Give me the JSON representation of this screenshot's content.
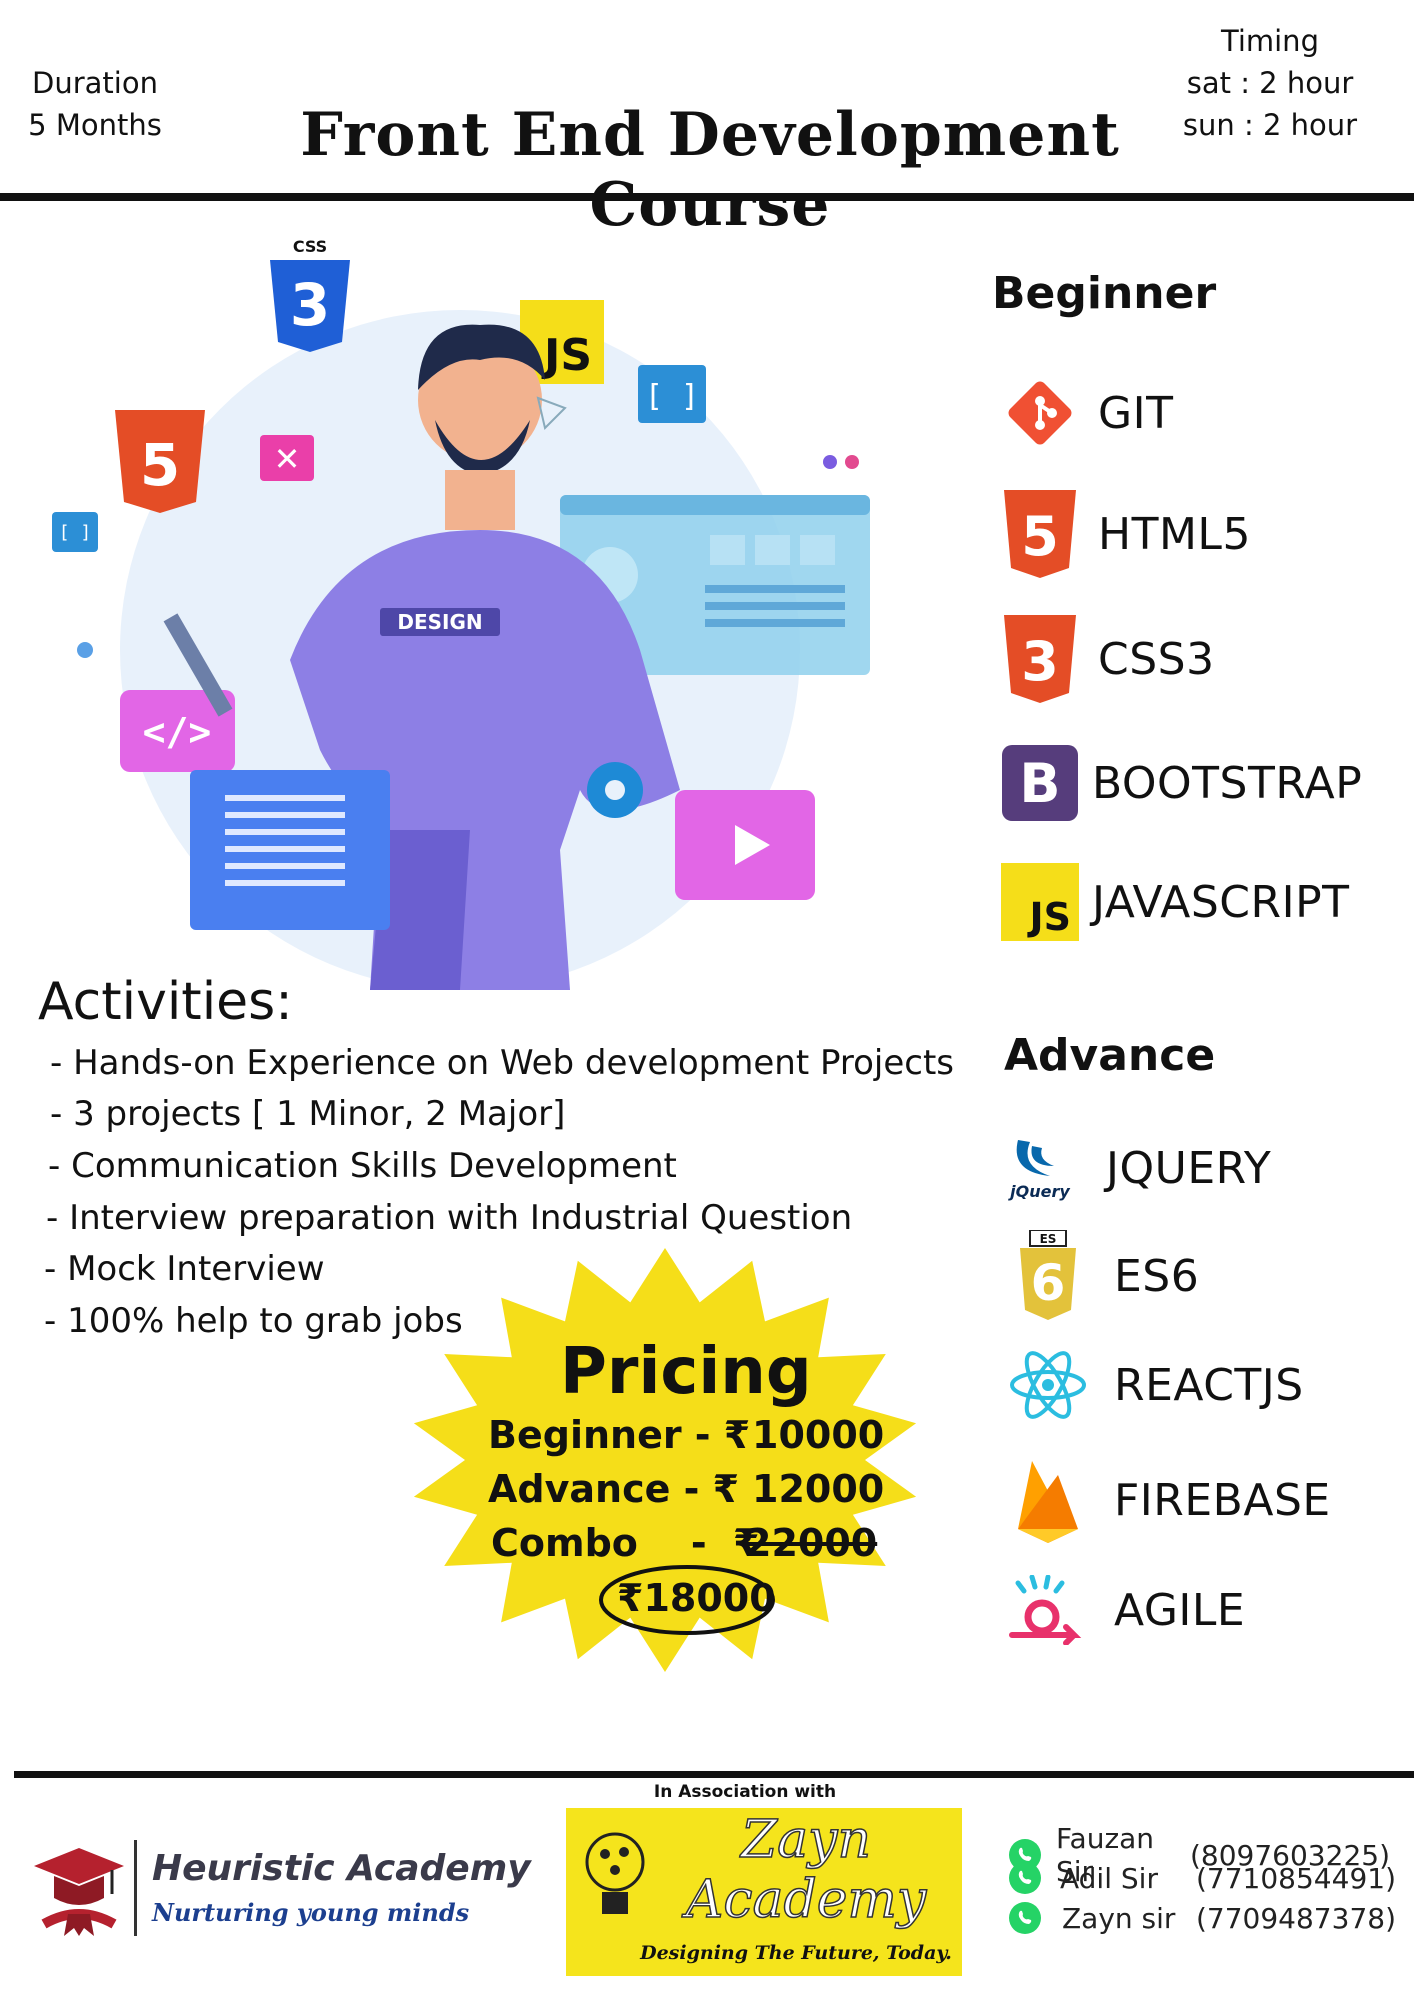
{
  "header": {
    "duration_label": "Duration",
    "duration_value": "5 Months",
    "title": "Front End Development Course",
    "timing_label": "Timing",
    "timing_sat": "sat : 2 hour",
    "timing_sun": "sun : 2 hour"
  },
  "hero": {
    "shirt_text": "DESIGN",
    "css_badge": "CSS",
    "js_badge": "JS"
  },
  "beginner": {
    "heading": "Beginner",
    "items": [
      {
        "label": "GIT",
        "icon": "git-icon"
      },
      {
        "label": "HTML5",
        "icon": "html5-icon"
      },
      {
        "label": "CSS3",
        "icon": "css3-icon"
      },
      {
        "label": "BOOTSTRAP",
        "icon": "bootstrap-icon"
      },
      {
        "label": "JAVASCRIPT",
        "icon": "javascript-icon"
      }
    ]
  },
  "advance": {
    "heading": "Advance",
    "items": [
      {
        "label": "JQUERY",
        "icon": "jquery-icon"
      },
      {
        "label": "ES6",
        "icon": "es6-icon"
      },
      {
        "label": "REACTJS",
        "icon": "react-icon"
      },
      {
        "label": "FIREBASE",
        "icon": "firebase-icon"
      },
      {
        "label": "AGILE",
        "icon": "agile-icon"
      }
    ]
  },
  "icon_text": {
    "jquery": "jQuery",
    "es_top": "ES",
    "es_num": "6",
    "bootstrap": "B",
    "js": "JS"
  },
  "activities": {
    "title": "Activities:",
    "items": [
      "- Hands-on Experience on Web development Projects",
      "- 3 projects [ 1 Minor, 2 Major]",
      "- Communication Skills Development",
      "- Interview preparation with Industrial Question",
      "- Mock Interview",
      "- 100% help to grab jobs"
    ]
  },
  "pricing": {
    "title": "Pricing",
    "beginner_label": "Beginner - ₹",
    "beginner_price": "10000",
    "advance_label": "Advance -  ₹",
    "advance_price": "12000",
    "combo_label": "Combo    -  ₹",
    "combo_old_price": "22000",
    "combo_new_price": "₹18000"
  },
  "footer": {
    "academy_name": "Heuristic Academy",
    "academy_tagline": "Nurturing young minds",
    "association": "In Association with",
    "zayn_line1": "Zayn",
    "zayn_line2": "Academy",
    "zayn_tagline": "Designing The Future, Today.",
    "contacts": [
      {
        "name": "Fauzan Sir",
        "phone": "(8097603225)"
      },
      {
        "name": "Adil Sir",
        "phone": "(7710854491)"
      },
      {
        "name": "Zayn sir",
        "phone": "(7709487378)"
      }
    ]
  },
  "colors": {
    "accent_yellow": "#f5de19",
    "html_orange": "#e44d26",
    "css_blue": "#1f5fd6",
    "bootstrap_purple": "#563d7c",
    "git_red": "#f05033",
    "react_cyan": "#2bbde0",
    "whatsapp_green": "#25d366",
    "agile_pink": "#e8316b"
  }
}
